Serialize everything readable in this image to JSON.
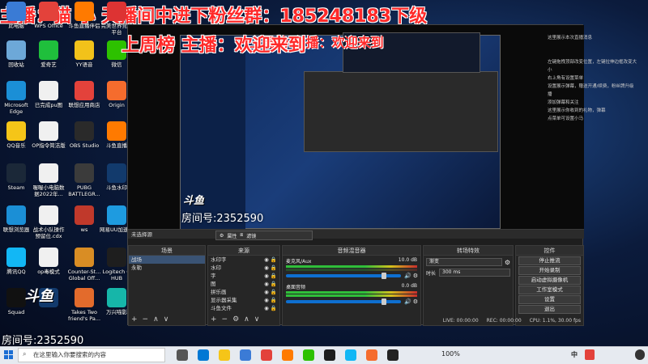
{
  "overlay": {
    "line1": "主播：猫 小 天播间中进下粉丝群：185248183下级",
    "line2": "上周榜 主播：欢迎来到"
  },
  "desktop_icons": [
    {
      "label": "此电脑",
      "icon": "computer-icon",
      "color": "#3a7bd5"
    },
    {
      "label": "WPS Office",
      "icon": "wps-icon",
      "color": "#e3423b"
    },
    {
      "label": "斗鱼直播伴侣",
      "icon": "douyu-icon",
      "color": "#ff7a00"
    },
    {
      "label": "完美世界竞技平台",
      "icon": "perfect-world-icon",
      "color": "#d33"
    },
    {
      "label": "回收站",
      "icon": "recycle-bin-icon",
      "color": "#6da8d8"
    },
    {
      "label": "爱奇艺",
      "icon": "iqiyi-icon",
      "color": "#1fbf3c"
    },
    {
      "label": "YY语音",
      "icon": "yy-icon",
      "color": "#f2c21a"
    },
    {
      "label": "微信",
      "icon": "wechat-icon",
      "color": "#2dc100"
    },
    {
      "label": "Microsoft Edge",
      "icon": "edge-icon",
      "color": "#1b8fd6"
    },
    {
      "label": "已完成pu图",
      "icon": "file-icon",
      "color": "#f0f0f0"
    },
    {
      "label": "联想应用商店",
      "icon": "lenovo-store-icon",
      "color": "#e3423b"
    },
    {
      "label": "Origin",
      "icon": "origin-icon",
      "color": "#f56c2d"
    },
    {
      "label": "QQ音乐",
      "icon": "qq-music-icon",
      "color": "#f5c518"
    },
    {
      "label": "OP指令简洁版",
      "icon": "file-icon",
      "color": "#f0f0f0"
    },
    {
      "label": "OBS Studio",
      "icon": "obs-icon",
      "color": "#2a2a2a"
    },
    {
      "label": "斗鱼直播",
      "icon": "douyu-live-icon",
      "color": "#ff7a00"
    },
    {
      "label": "Steam",
      "icon": "steam-icon",
      "color": "#1b2838"
    },
    {
      "label": "喔喔小电脑数据2022年...",
      "icon": "file-icon",
      "color": "#f0f0f0"
    },
    {
      "label": "PUBG BATTLEGR...",
      "icon": "pubg-icon",
      "color": "#3b3b3b"
    },
    {
      "label": "斗鱼水印",
      "icon": "douyu-watermark-icon",
      "color": "#123a6c"
    },
    {
      "label": "联想浏览器",
      "icon": "lenovo-browser-icon",
      "color": "#1b8fd6"
    },
    {
      "label": "战术小队操作预留位.cdx",
      "icon": "file-icon",
      "color": "#f0f0f0"
    },
    {
      "label": "ws",
      "icon": "ws-icon",
      "color": "#c0392b"
    },
    {
      "label": "网易UU加速器",
      "icon": "uu-icon",
      "color": "#1e9be0"
    },
    {
      "label": "腾讯QQ",
      "icon": "qq-icon",
      "color": "#12b7f5"
    },
    {
      "label": "op毒模式",
      "icon": "file-icon",
      "color": "#f0f0f0"
    },
    {
      "label": "Counter-St... Global Off...",
      "icon": "csgo-icon",
      "color": "#d98d24"
    },
    {
      "label": "Logitech G HUB",
      "icon": "logitech-icon",
      "color": "#1e1e1e"
    },
    {
      "label": "Squad",
      "icon": "squad-icon",
      "color": "#111"
    },
    {
      "label": "",
      "icon": "douyu-logo-icon",
      "color": "#123a6c"
    },
    {
      "label": "Takes Two friend's Pa...",
      "icon": "it-takes-two-icon",
      "color": "#e36b2c"
    },
    {
      "label": "万兴喵影",
      "icon": "wondershare-icon",
      "color": "#16b6a9"
    }
  ],
  "obs": {
    "status_label": "未选择源",
    "properties_btn": "属性",
    "filters_btn": "滤镜",
    "scenes": {
      "title": "场景",
      "items": [
        "战场",
        "永勒"
      ]
    },
    "sources": {
      "title": "来源",
      "items": [
        "水印字",
        "水印",
        "字",
        "图",
        "拼乐画",
        "显示器采集",
        "斗鱼文件"
      ]
    },
    "mixer": {
      "title": "音频混音器",
      "track1": {
        "name": "麦克风/Aux",
        "value": "10.0 dB"
      },
      "track2": {
        "name": "桌面音频",
        "value": "0.0 dB"
      }
    },
    "transition": {
      "title": "转场特效",
      "type": "渐变",
      "duration_label": "时长",
      "duration_value": "300 ms"
    },
    "controls": {
      "title": "控件",
      "buttons": [
        "停止推流",
        "开始录制",
        "启动虚拟摄像机",
        "工作室模式",
        "设置",
        "退出"
      ]
    },
    "status_bar": {
      "live": "LIVE: 00:00:00",
      "rec": "REC: 00:00:00",
      "cpu": "CPU: 1.1%, 30.00 fps"
    }
  },
  "chat_lines": [
    "这里展示本次直播消息",
    "左键拖拽顶部改变位置，左键拉伸边框改变大",
    "小",
    "右上角有设置菜单",
    "设置展示弹幕，赠送开通/续费，粉丝牌升级",
    "播",
    "添加弹幕和关注",
    "这里展示你收到的礼物，弹幕",
    "点菜单可设置小马"
  ],
  "room": "房间号:2352590",
  "room_small": "房间号:2352590",
  "taskbar": {
    "search_placeholder": "在这里输入你要搜索的内容",
    "battery": "100%",
    "ime": "中"
  }
}
